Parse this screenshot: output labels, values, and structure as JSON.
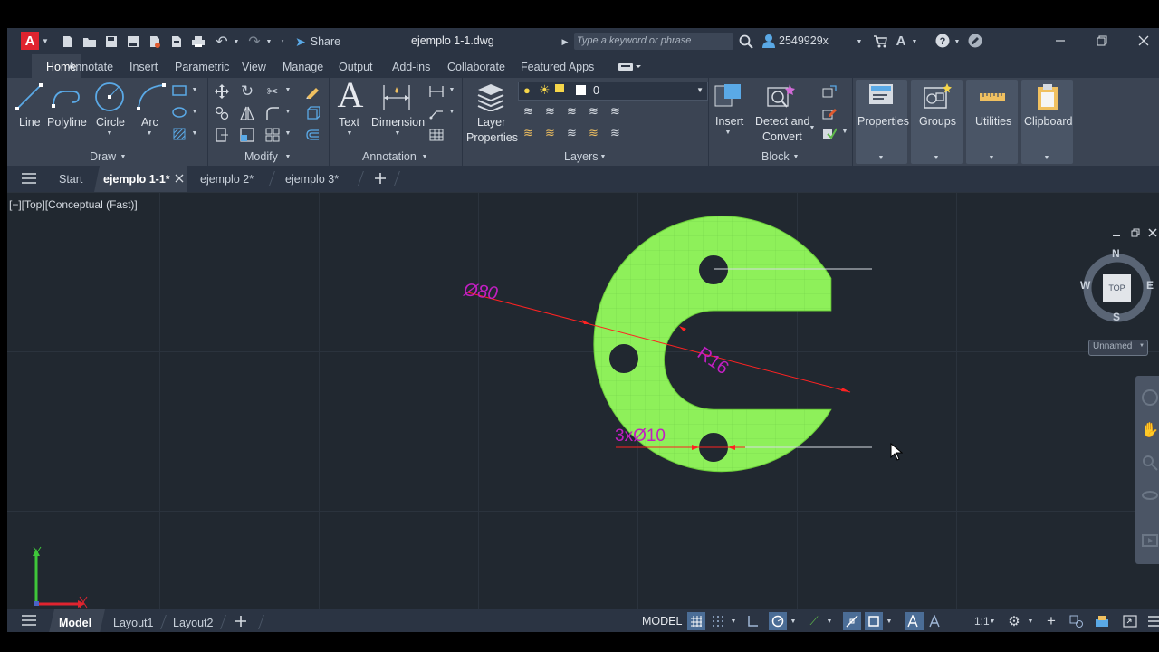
{
  "titlebar": {
    "app_logo": "A",
    "share_label": "Share",
    "document_title": "ejemplo 1-1.dwg",
    "search_placeholder": "Type a keyword or phrase",
    "user_name": "2549929x"
  },
  "menu": {
    "tabs": [
      {
        "label": "Home",
        "active": true
      },
      {
        "label": "Annotate"
      },
      {
        "label": "Insert"
      },
      {
        "label": "Parametric"
      },
      {
        "label": "View"
      },
      {
        "label": "Manage"
      },
      {
        "label": "Output"
      },
      {
        "label": "Add-ins"
      },
      {
        "label": "Collaborate"
      },
      {
        "label": "Featured Apps"
      }
    ]
  },
  "ribbon": {
    "draw": {
      "title": "Draw",
      "line": "Line",
      "polyline": "Polyline",
      "circle": "Circle",
      "arc": "Arc"
    },
    "modify": {
      "title": "Modify"
    },
    "annotation": {
      "title": "Annotation",
      "text": "Text",
      "dimension": "Dimension"
    },
    "layers": {
      "title": "Layers",
      "layer_properties_1": "Layer",
      "layer_properties_2": "Properties",
      "current_layer": "0"
    },
    "block": {
      "title": "Block",
      "insert": "Insert",
      "detect_1": "Detect and",
      "detect_2": "Convert"
    },
    "properties": "Properties",
    "groups": "Groups",
    "utilities": "Utilities",
    "clipboard": "Clipboard"
  },
  "tabs": {
    "start": "Start",
    "files": [
      {
        "label": "ejemplo 1-1*",
        "active": true
      },
      {
        "label": "ejemplo 2*"
      },
      {
        "label": "ejemplo 3*"
      }
    ]
  },
  "viewport": {
    "view_label": "[−][Top][Conceptual (Fast)]",
    "dim_diameter": "Ø80",
    "dim_radius": "R16",
    "dim_holes": "3xØ10",
    "viewcube": {
      "n": "N",
      "s": "S",
      "e": "E",
      "w": "W",
      "face": "TOP",
      "ucs": "Unnamed"
    },
    "colors": {
      "part_fill": "#8ef05a",
      "dimension": "#c21fc2",
      "dim_line": "#ff2222"
    }
  },
  "statusbar": {
    "model_tab": "Model",
    "layouts": [
      "Layout1",
      "Layout2"
    ],
    "space": "MODEL",
    "scale": "1:1"
  }
}
